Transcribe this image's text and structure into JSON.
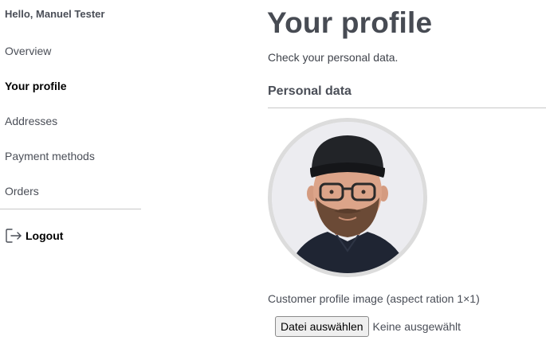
{
  "sidebar": {
    "greeting": "Hello, Manuel Tester",
    "items": [
      {
        "label": "Overview",
        "active": false
      },
      {
        "label": "Your profile",
        "active": true
      },
      {
        "label": "Addresses",
        "active": false
      },
      {
        "label": "Payment methods",
        "active": false
      },
      {
        "label": "Orders",
        "active": false
      }
    ],
    "logout": {
      "label": "Logout",
      "icon": "logout-icon"
    }
  },
  "main": {
    "title": "Your profile",
    "subtitle": "Check your personal data.",
    "section_heading": "Personal data",
    "profile_image": {
      "description_icon": "avatar-photo",
      "label": "Customer profile image (aspect ration 1×1)"
    },
    "file_input": {
      "button_label": "Datei auswählen",
      "status": "Keine ausgewählt"
    }
  },
  "colors": {
    "text": "#4a4e57",
    "active_text": "#000000",
    "divider": "#c8c8c8",
    "avatar_border": "#dcdcdc"
  }
}
